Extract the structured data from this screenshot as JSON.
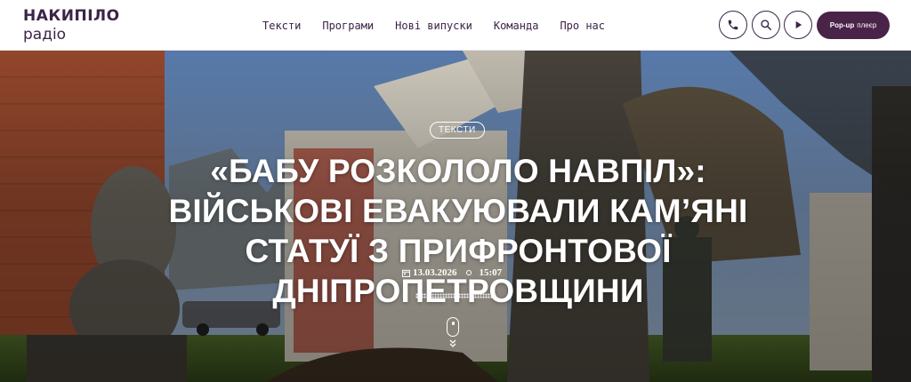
{
  "header": {
    "logo": {
      "line1": "НАКИПІЛО",
      "line2": "радіо"
    },
    "nav": [
      {
        "label": "Тексти"
      },
      {
        "label": "Програми"
      },
      {
        "label": "Нові випуски"
      },
      {
        "label": "Команда"
      },
      {
        "label": "Про нас"
      }
    ],
    "buttons": {
      "phone_icon": "phone-icon",
      "search_icon": "search-icon",
      "play_icon": "play-icon",
      "popup": {
        "bold": "Pop-up",
        "rest": "плеєр"
      }
    }
  },
  "hero": {
    "tag": "Тексти",
    "headline": "«БАБУ РОЗКОЛОЛО НАВПІЛ»: ВІЙСЬКОВІ ЕВАКУЮВАЛИ КАМ’ЯНІ СТАТУЇ З ПРИФРОНТОВОЇ ДНІПРОПЕТРОВЩИНИ",
    "date": "13.03.2026",
    "time": "15:07"
  },
  "colors": {
    "brand": "#3b2447",
    "accent": "#c22a6a",
    "popup_bg": "#4a2348"
  }
}
